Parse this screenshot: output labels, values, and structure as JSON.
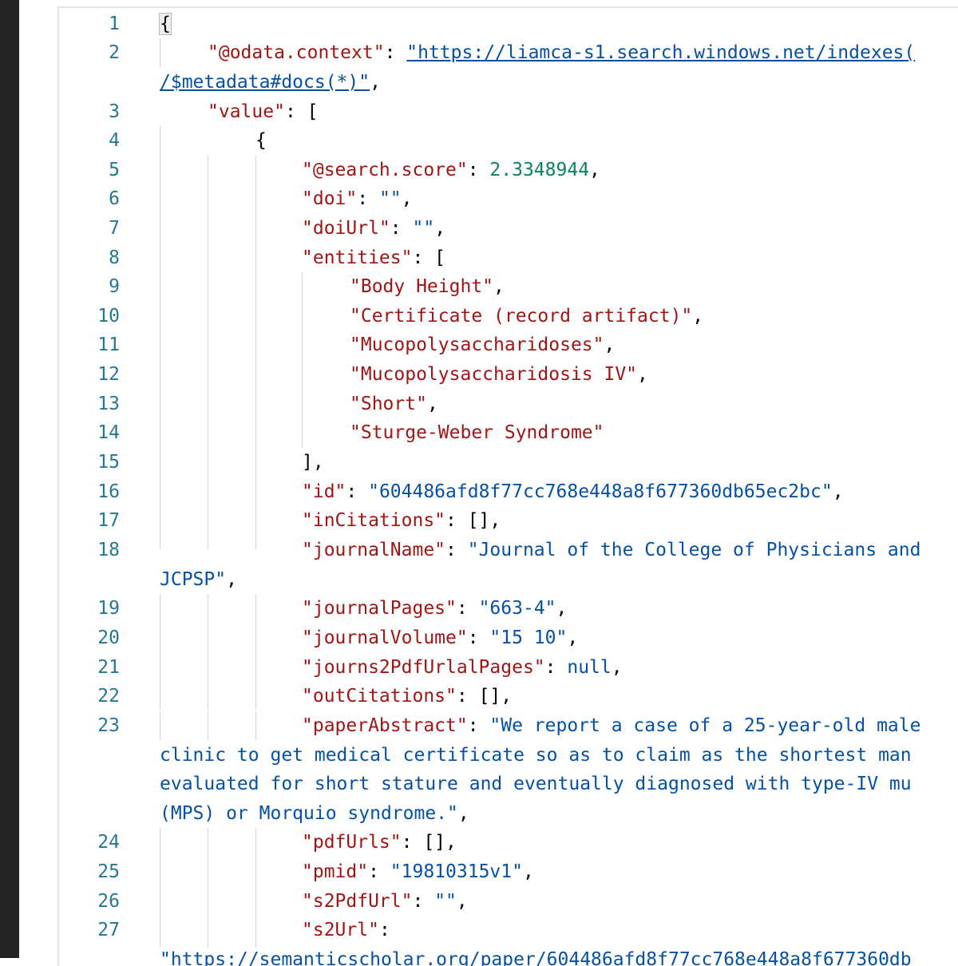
{
  "editor": {
    "line_numbers": [
      "1",
      "2",
      "3",
      "4",
      "5",
      "6",
      "7",
      "8",
      "9",
      "10",
      "11",
      "12",
      "13",
      "14",
      "15",
      "16",
      "17",
      "18",
      "19",
      "20",
      "21",
      "22",
      "23",
      "24",
      "25",
      "26",
      "27"
    ],
    "lines": {
      "l1": "{",
      "l2_key": "\"@odata.context\"",
      "l2_val": "\"https://liamca-s1.search.windows.net/indexes(",
      "l2_wrap": "/$metadata#docs(*)\"",
      "l3_key": "\"value\"",
      "l4": "{",
      "l5_key": "\"@search.score\"",
      "l5_val": "2.3348944",
      "l6_key": "\"doi\"",
      "l6_val": "\"\"",
      "l7_key": "\"doiUrl\"",
      "l7_val": "\"\"",
      "l8_key": "\"entities\"",
      "l9": "\"Body Height\"",
      "l10": "\"Certificate (record artifact)\"",
      "l11": "\"Mucopolysaccharidoses\"",
      "l12": "\"Mucopolysaccharidosis IV\"",
      "l13": "\"Short\"",
      "l14": "\"Sturge-Weber Syndrome\"",
      "l16_key": "\"id\"",
      "l16_val": "\"604486afd8f77cc768e448a8f677360db65ec2bc\"",
      "l17_key": "\"inCitations\"",
      "l18_key": "\"journalName\"",
      "l18_val": "\"Journal of the College of Physicians and",
      "l18_wrap": "JCPSP\"",
      "l19_key": "\"journalPages\"",
      "l19_val": "\"663-4\"",
      "l20_key": "\"journalVolume\"",
      "l20_val": "\"15 10\"",
      "l21_key": "\"journs2PdfUrlalPages\"",
      "l21_val": "null",
      "l22_key": "\"outCitations\"",
      "l23_key": "\"paperAbstract\"",
      "l23_val": "\"We report a case of a 25-year-old male",
      "l23_wrap1": "clinic to get medical certificate so as to claim as the shortest man",
      "l23_wrap2": "evaluated for short stature and eventually diagnosed with type-IV mu",
      "l23_wrap3": "(MPS) or Morquio syndrome.\"",
      "l24_key": "\"pdfUrls\"",
      "l25_key": "\"pmid\"",
      "l25_val": "\"19810315v1\"",
      "l26_key": "\"s2PdfUrl\"",
      "l26_val": "\"\"",
      "l27_key": "\"s2Url\"",
      "l27_wrap": "\"https://semanticscholar.org/paper/604486afd8f77cc768e448a8f677360db"
    }
  }
}
